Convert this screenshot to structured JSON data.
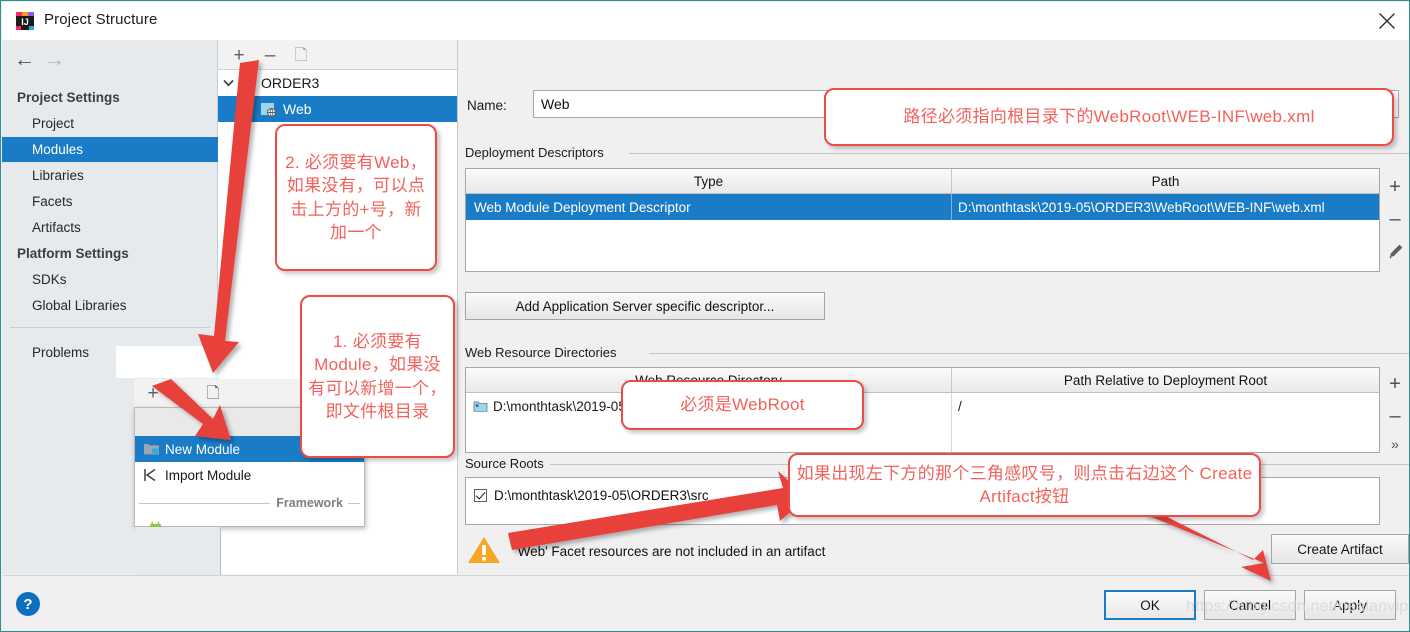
{
  "window": {
    "title": "Project Structure",
    "app_icon": "intellij-idea-icon",
    "close_icon": "close-icon"
  },
  "sidebar": {
    "back_icon": "arrow-left-icon",
    "forward_icon": "arrow-right-icon",
    "groups": [
      {
        "label": "Project Settings",
        "items": [
          "Project",
          "Modules",
          "Libraries",
          "Facets",
          "Artifacts"
        ]
      },
      {
        "label": "Platform Settings",
        "items": [
          "SDKs",
          "Global Libraries"
        ]
      }
    ],
    "problems_label": "Problems",
    "selected_item": "Modules"
  },
  "module_tree": {
    "toolbar": {
      "add_icon": "plus-icon",
      "remove_icon": "minus-icon",
      "copy_icon": "copy-icon"
    },
    "nodes": [
      {
        "label": "ORDER3",
        "selected": false,
        "expanded": true
      },
      {
        "label": "Web",
        "selected": true,
        "expanded": false
      }
    ]
  },
  "context_menu": {
    "toolbar": {
      "add_icon": "plus-icon",
      "remove_icon": "minus-icon",
      "copy_icon": "copy-icon"
    },
    "items": [
      {
        "label": "New Module",
        "icon": "module-icon",
        "selected": true
      },
      {
        "label": "Import Module",
        "icon": "import-icon",
        "selected": false
      }
    ],
    "separator_label": "Framework"
  },
  "main": {
    "name_label": "Name:",
    "name_value": "Web",
    "deployment_descriptors": {
      "group_label": "Deployment Descriptors",
      "columns": [
        "Type",
        "Path"
      ],
      "rows": [
        {
          "type": "Web Module Deployment Descriptor",
          "path": "D:\\monthtask\\2019-05\\ORDER3\\WebRoot\\WEB-INF\\web.xml",
          "selected": true
        }
      ],
      "side_buttons": [
        {
          "name": "add-descriptor-button",
          "glyph": "+"
        },
        {
          "name": "remove-descriptor-button",
          "glyph": "–"
        },
        {
          "name": "edit-descriptor-button",
          "glyph": "pencil-icon"
        }
      ],
      "add_specific_button": "Add Application Server specific descriptor..."
    },
    "web_resource_directories": {
      "group_label": "Web Resource Directories",
      "columns": [
        "Web Resource Directory",
        "Path Relative to Deployment Root"
      ],
      "rows": [
        {
          "directory": "D:\\monthtask\\2019-05\\ORDER3\\WebRoot",
          "relative": "/",
          "icon": "folder-icon"
        }
      ],
      "side_buttons": [
        {
          "name": "add-web-resource-button",
          "glyph": "+"
        },
        {
          "name": "remove-web-resource-button",
          "glyph": "–"
        },
        {
          "name": "more-web-resource-button",
          "glyph": "»"
        }
      ]
    },
    "source_roots": {
      "group_label": "Source Roots",
      "rows": [
        {
          "path": "D:\\monthtask\\2019-05\\ORDER3\\src",
          "checked": true
        }
      ]
    },
    "warning": {
      "icon": "warning-triangle-icon",
      "text": "'Web' Facet resources are not included in an artifact",
      "action_button": "Create Artifact"
    }
  },
  "footer": {
    "help_icon": "question-mark-icon",
    "buttons": [
      {
        "label": "OK",
        "default": true
      },
      {
        "label": "Cancel",
        "default": false
      },
      {
        "label": "Apply",
        "default": false
      }
    ]
  },
  "annotations": {
    "callout_web": "2. 必须要有Web，如果没有，可以点击上方的+号，新加一个",
    "callout_module": "1. 必须要有Module，如果没有可以新增一个，即文件根目录",
    "callout_path": "路径必须指向根目录下的WebRoot\\WEB-INF\\web.xml",
    "callout_webroot": "必须是WebRoot",
    "callout_artifact": "如果出现左下方的那个三角感叹号，则点击右边这个 Create Artifact按钮",
    "arrow_color": "#e8403a"
  },
  "watermark": "https://blog.csdn.net/nealanvip"
}
